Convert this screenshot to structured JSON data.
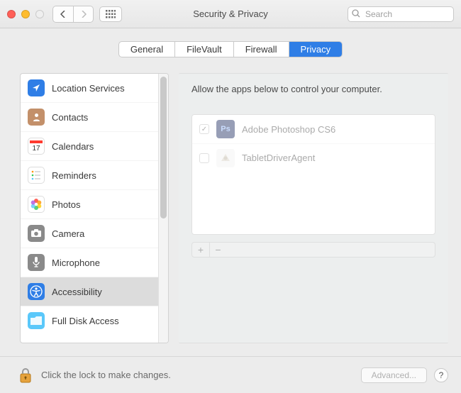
{
  "header": {
    "title": "Security & Privacy"
  },
  "search": {
    "placeholder": "Search"
  },
  "tabs": {
    "general": "General",
    "filevault": "FileVault",
    "firewall": "Firewall",
    "privacy": "Privacy"
  },
  "sidebar": {
    "items": [
      {
        "label": "Location Services",
        "icon": "location-arrow",
        "color": "#2f7ee6"
      },
      {
        "label": "Contacts",
        "icon": "contacts",
        "color": "#c3906a"
      },
      {
        "label": "Calendars",
        "icon": "calendar",
        "color": "#ffffff",
        "badge": "17"
      },
      {
        "label": "Reminders",
        "icon": "reminders",
        "color": "#ffffff"
      },
      {
        "label": "Photos",
        "icon": "photos",
        "color": "#ffffff"
      },
      {
        "label": "Camera",
        "icon": "camera",
        "color": "#8a8a8a"
      },
      {
        "label": "Microphone",
        "icon": "microphone",
        "color": "#8a8a8a"
      },
      {
        "label": "Accessibility",
        "icon": "accessibility",
        "color": "#2f7ee6",
        "selected": true
      },
      {
        "label": "Full Disk Access",
        "icon": "folder",
        "color": "#5ac8fa"
      }
    ]
  },
  "main": {
    "prompt": "Allow the apps below to control your computer.",
    "apps": [
      {
        "name": "Adobe Photoshop CS6",
        "checked": true,
        "icon": "ps"
      },
      {
        "name": "TabletDriverAgent",
        "checked": false,
        "icon": "generic"
      }
    ],
    "plus": "+",
    "minus": "−"
  },
  "footer": {
    "lock_text": "Click the lock to make changes.",
    "advanced": "Advanced...",
    "help": "?"
  },
  "colors": {
    "accent": "#2f7ee6"
  }
}
